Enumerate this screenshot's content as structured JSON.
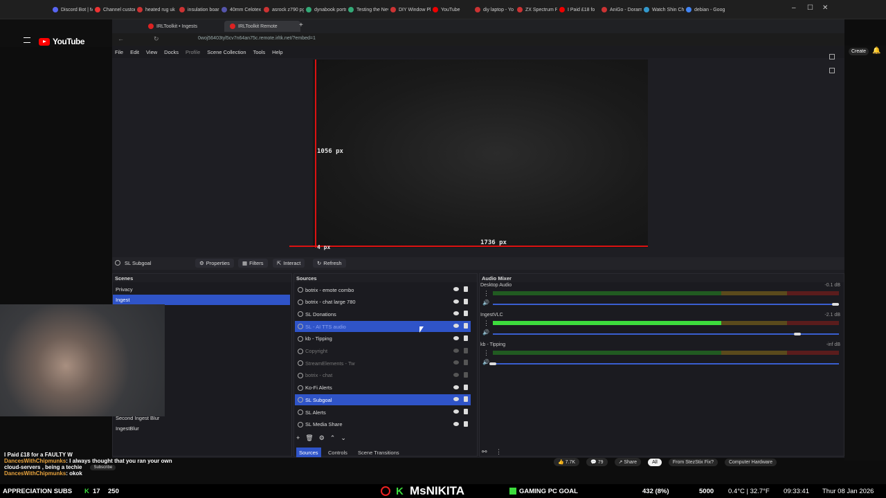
{
  "browser_tabs": [
    {
      "label": "Discord Bot | M"
    },
    {
      "label": "Channel custor"
    },
    {
      "label": "heated rug uk"
    },
    {
      "label": "insulation boar"
    },
    {
      "label": "40mm Celotex"
    },
    {
      "label": "asrock z790 pg"
    },
    {
      "label": "dynabook portr"
    },
    {
      "label": "Testing the Nev"
    },
    {
      "label": "DIY Window Pl"
    },
    {
      "label": "YouTube"
    },
    {
      "label": "diy laptop - Yo"
    },
    {
      "label": "ZX Spectrum P"
    },
    {
      "label": "I Paid £18 fo"
    },
    {
      "label": "AniGo - Doram"
    },
    {
      "label": "Watch Shin Ch"
    },
    {
      "label": "debian - Goog"
    }
  ],
  "inner_tabs": [
    {
      "label": "IRLToolkit • Ingests"
    },
    {
      "label": "IRLToolkit Remote"
    }
  ],
  "url": "0woj56403tyl5cv7n64an75c.remote.irltk.net/?embed=1",
  "youtube": {
    "logo": "YouTube",
    "create": "Create"
  },
  "menu": [
    "File",
    "Edit",
    "View",
    "Docks",
    "Profile",
    "Scene Collection",
    "Tools",
    "Help"
  ],
  "preview": {
    "height_readout": "1056 px",
    "width_readout": "1736 px",
    "offset_readout": "4 px"
  },
  "toolbar": {
    "current_source": "SL Subgoal",
    "properties": "Properties",
    "filters": "Filters",
    "interact": "Interact",
    "refresh": "Refresh"
  },
  "scenes": {
    "title": "Scenes",
    "items": [
      "Privacy",
      "Ingest",
      "Second Ingest Blur",
      "IngestBlur"
    ],
    "selected": "Ingest"
  },
  "sources": {
    "title": "Sources",
    "items": [
      {
        "label": "botrix - emote combo",
        "dim": false
      },
      {
        "label": "botrix - chat large 780",
        "dim": false
      },
      {
        "label": "SL Donations",
        "dim": false
      },
      {
        "label": "SL - AI TTS audio",
        "dim": false
      },
      {
        "label": "kb - Tipping",
        "dim": false
      },
      {
        "label": "Copyright",
        "dim": true
      },
      {
        "label": "StreamElements - Tw",
        "dim": true
      },
      {
        "label": "botrix - chat",
        "dim": true
      },
      {
        "label": "Ko-Fi Alerts",
        "dim": false
      },
      {
        "label": "SL Subgoal",
        "dim": false
      },
      {
        "label": "SL Alerts",
        "dim": false
      },
      {
        "label": "SL Media Share",
        "dim": false
      }
    ],
    "tabs": [
      "Sources",
      "Controls",
      "Scene Transitions"
    ]
  },
  "audio_mixer": {
    "title": "Audio Mixer",
    "channels": [
      {
        "name": "Desktop Audio",
        "db": "-0.1 dB",
        "level": 0.0,
        "volume": 0.99
      },
      {
        "name": "IngestVLC",
        "db": "-2.1 dB",
        "level": 0.66,
        "volume": 0.88
      },
      {
        "name": "kb - Tipping",
        "db": "-inf dB",
        "level": 0.0,
        "volume": 0.0
      }
    ]
  },
  "chat": [
    {
      "user": "",
      "text": "I Paid £18 for a FAULTY W"
    },
    {
      "user": "DancesWithChipmunks",
      "text": ": I always thought that you ran your own"
    },
    {
      "user": "",
      "text": "cloud-servers , being a techie"
    },
    {
      "user": "DancesWithChipmunks",
      "text": ": okok"
    }
  ],
  "yt_actions": {
    "likes": "7.7K",
    "comments": "79",
    "share": "Share",
    "chip_all": "All",
    "chip_1": "From StezStix Fix?",
    "chip_2": "Computer Hardware",
    "subscribe": "Subscribe"
  },
  "ticker": {
    "subs_label": "APPRECIATION SUBS",
    "subs_count": "17",
    "subs_goal": "250",
    "channel": "MsNIKITA",
    "goal_label": "GAMING PC GOAL",
    "goal_value": "432 (8%)",
    "goal_target": "5000",
    "weather": "0.4°C | 32.7°F",
    "time": "09:33:41",
    "date": "Thur 08 Jan 2026"
  },
  "colors": {
    "accent": "#2f54c8",
    "measure_red": "#dd1111",
    "meter_green": "#3ddc3d"
  }
}
